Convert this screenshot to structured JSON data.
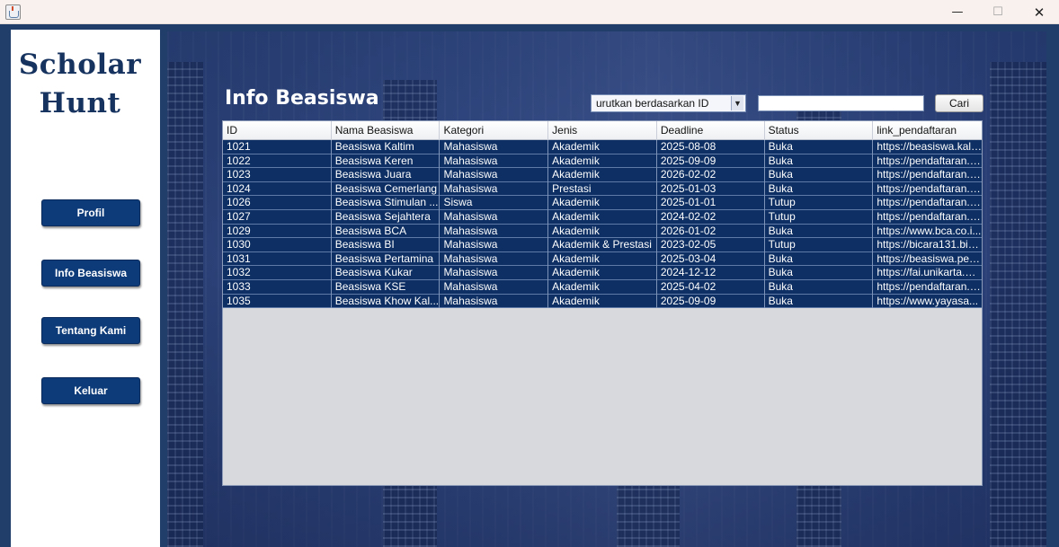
{
  "window": {
    "minimize_glyph": "—",
    "maximize_glyph": "☐",
    "close_glyph": "✕"
  },
  "sidebar": {
    "logo_line1": "Scholar",
    "logo_line2": "Hunt",
    "nav": [
      {
        "label": "Profil"
      },
      {
        "label": "Info Beasiswa"
      },
      {
        "label": "Tentang Kami"
      },
      {
        "label": "Keluar"
      }
    ]
  },
  "main": {
    "title": "Info Beasiswa",
    "sort_select": {
      "selected": "urutkan berdasarkan ID",
      "arrow": "▼"
    },
    "search": {
      "value": "",
      "button_label": "Cari"
    },
    "table": {
      "columns": [
        "ID",
        "Nama Beasiswa",
        "Kategori",
        "Jenis",
        "Deadline",
        "Status",
        "link_pendaftaran"
      ],
      "rows": [
        [
          "1021",
          "Beasiswa Kaltim",
          "Mahasiswa",
          "Akademik",
          "2025-08-08",
          "Buka",
          "https://beasiswa.kalti..."
        ],
        [
          "1022",
          "Beasiswa Keren",
          "Mahasiswa",
          "Akademik",
          "2025-09-09",
          "Buka",
          "https://pendaftaran.k..."
        ],
        [
          "1023",
          "Beasiswa Juara",
          "Mahasiswa",
          "Akademik",
          "2026-02-02",
          "Buka",
          "https://pendaftaran.ju..."
        ],
        [
          "1024",
          "Beasiswa Cemerlang",
          "Mahasiswa",
          "Prestasi",
          "2025-01-03",
          "Buka",
          "https://pendaftaran.c..."
        ],
        [
          "1026",
          "Beasiswa Stimulan ...",
          "Siswa",
          "Akademik",
          "2025-01-01",
          "Tutup",
          "https://pendaftaran.st..."
        ],
        [
          "1027",
          "Beasiswa Sejahtera",
          "Mahasiswa",
          "Akademik",
          "2024-02-02",
          "Tutup",
          "https://pendaftaran.s..."
        ],
        [
          "1029",
          "Beasiswa BCA",
          "Mahasiswa",
          "Akademik",
          "2026-01-02",
          "Buka",
          "https://www.bca.co.i..."
        ],
        [
          "1030",
          "Beasiswa BI",
          "Mahasiswa",
          "Akademik & Prestasi",
          "2023-02-05",
          "Tutup",
          "https://bicara131.bi.g..."
        ],
        [
          "1031",
          "Beasiswa Pertamina",
          "Mahasiswa",
          "Akademik",
          "2025-03-04",
          "Buka",
          "https://beasiswa.pert..."
        ],
        [
          "1032",
          "Beasiswa Kukar",
          "Mahasiswa",
          "Akademik",
          "2024-12-12",
          "Buka",
          "https://fai.unikarta.ac..."
        ],
        [
          "1033",
          "Beasiswa KSE",
          "Mahasiswa",
          "Akademik",
          "2025-04-02",
          "Buka",
          "https://pendaftaran.b..."
        ],
        [
          "1035",
          "Beasiswa Khow Kal...",
          "Mahasiswa",
          "Akademik",
          "2025-09-09",
          "Buka",
          "https://www.yayasa..."
        ]
      ]
    }
  },
  "colors": {
    "primary": "#0d3a78",
    "row_bg": "#0d2f63",
    "frame": "#213e6a"
  }
}
